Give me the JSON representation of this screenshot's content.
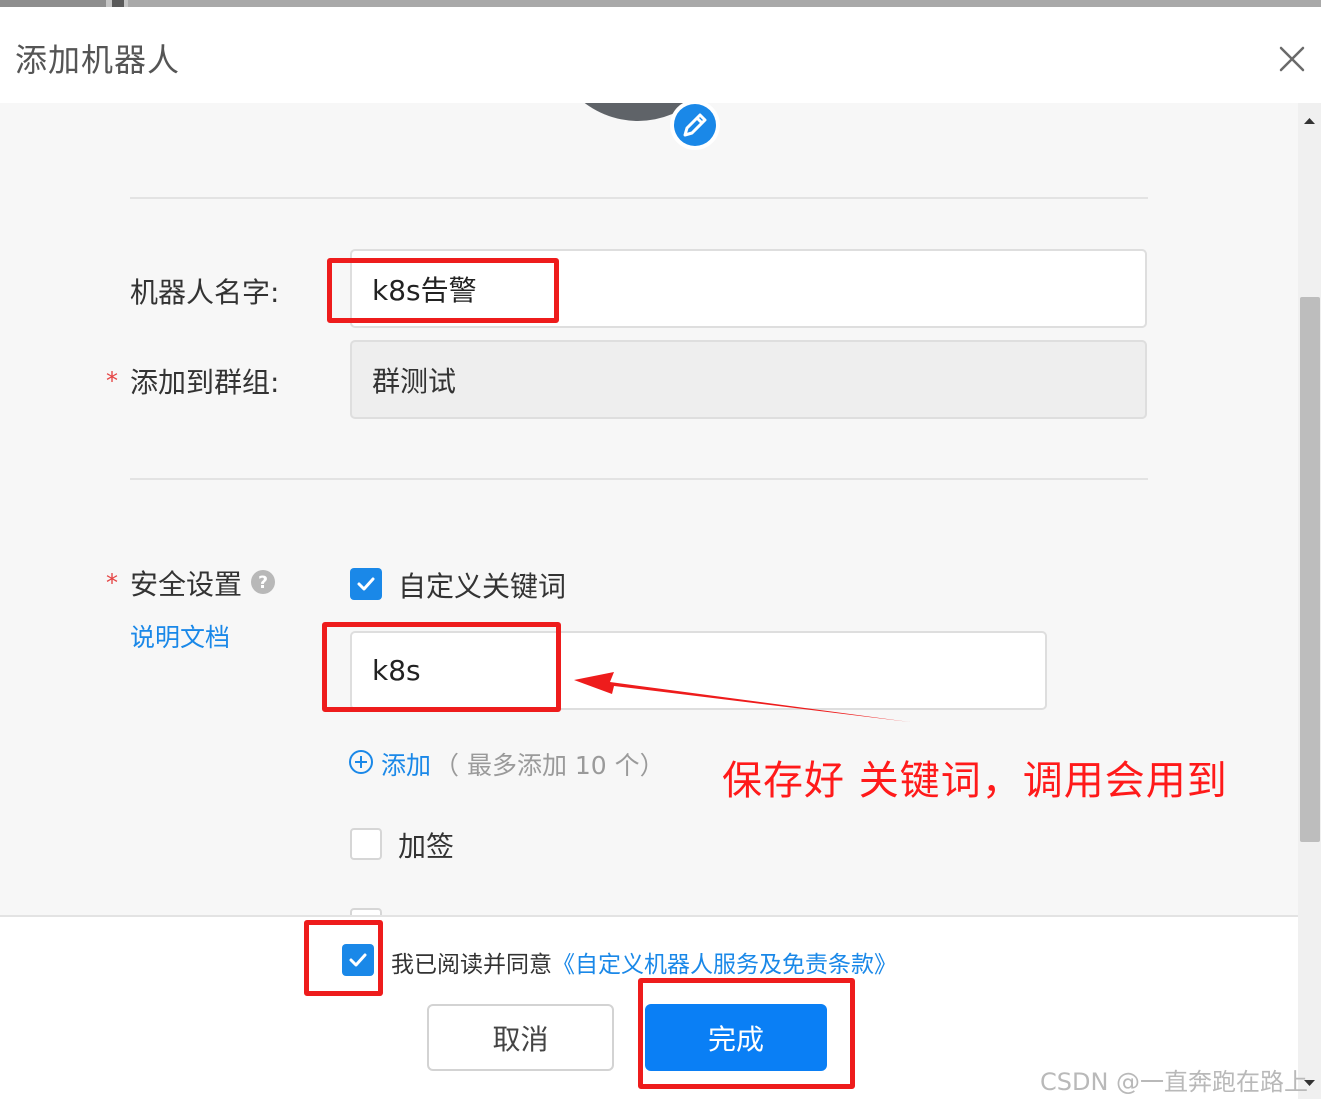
{
  "dialog": {
    "title": "添加机器人"
  },
  "form": {
    "robot_name_label": "机器人名字:",
    "robot_name_value": "k8s告警",
    "group_label": "添加到群组:",
    "group_value": "群测试",
    "required_mark": "*",
    "security_label": "安全设置",
    "docs_link": "说明文档",
    "keyword_option": {
      "label": "自定义关键词",
      "checked": true
    },
    "keyword_value": "k8s",
    "add_label": "添加",
    "add_hint": "（ 最多添加 10 个）",
    "sign_option": {
      "label": "加签",
      "checked": false
    }
  },
  "annotation": {
    "note": "保存好 关键词，调用会用到"
  },
  "footer": {
    "agree_checked": true,
    "agree_text": "我已阅读并同意",
    "agree_link": "《自定义机器人服务及免责条款》",
    "cancel_label": "取消",
    "done_label": "完成"
  },
  "watermark": "CSDN @一直奔跑在路上",
  "colors": {
    "primary": "#0a7ff5",
    "highlight": "#ee1c1c",
    "required": "#e54545"
  },
  "icons": [
    "close-icon",
    "edit-pencil-icon",
    "help-circle-icon",
    "check-icon",
    "add-circle-icon",
    "arrow-annotation"
  ]
}
